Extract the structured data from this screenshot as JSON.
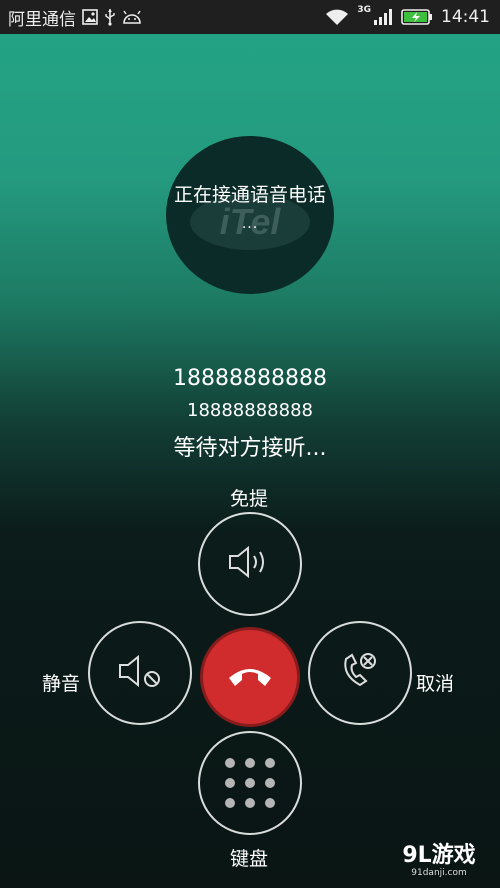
{
  "status_bar": {
    "carrier": "阿里通信",
    "network": "3G",
    "time": "14:41",
    "icons": [
      "image-icon",
      "usb-icon",
      "android-icon",
      "wifi-icon",
      "signal-icon",
      "battery-charging-icon"
    ]
  },
  "call": {
    "avatar_status": "正在接通语音电话",
    "avatar_dots": "...",
    "avatar_logo_text": "iTel",
    "number": "18888888888",
    "number_sub": "18888888888",
    "status": "等待对方接听..."
  },
  "controls": {
    "speaker_label": "免提",
    "mute_label": "静音",
    "cancel_label": "取消",
    "keypad_label": "键盘",
    "hangup_color": "#d12c2d"
  },
  "watermark": {
    "main": "9L游戏",
    "sub": "91danji.com"
  }
}
